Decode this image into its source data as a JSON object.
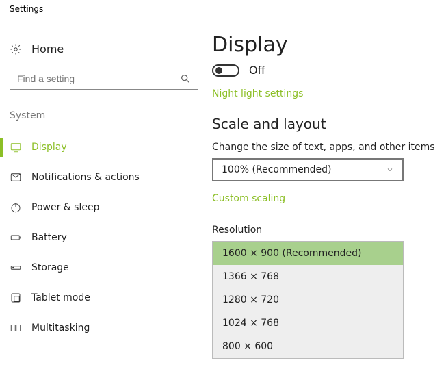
{
  "window_title": "Settings",
  "home": {
    "label": "Home"
  },
  "search": {
    "placeholder": "Find a setting"
  },
  "section": {
    "label": "System"
  },
  "nav": [
    {
      "label": "Display",
      "active": true
    },
    {
      "label": "Notifications & actions"
    },
    {
      "label": "Power & sleep"
    },
    {
      "label": "Battery"
    },
    {
      "label": "Storage"
    },
    {
      "label": "Tablet mode"
    },
    {
      "label": "Multitasking"
    }
  ],
  "display": {
    "heading": "Display",
    "toggle_state": "Off",
    "night_light_link": "Night light settings",
    "scale_heading": "Scale and layout",
    "scale_label": "Change the size of text, apps, and other items",
    "scale_value": "100% (Recommended)",
    "custom_scaling_link": "Custom scaling",
    "resolution_label": "Resolution",
    "resolutions": [
      {
        "label": "1600 × 900 (Recommended)",
        "selected": true
      },
      {
        "label": "1366 × 768"
      },
      {
        "label": "1280 × 720"
      },
      {
        "label": "1024 × 768"
      },
      {
        "label": "800 × 600"
      }
    ]
  }
}
